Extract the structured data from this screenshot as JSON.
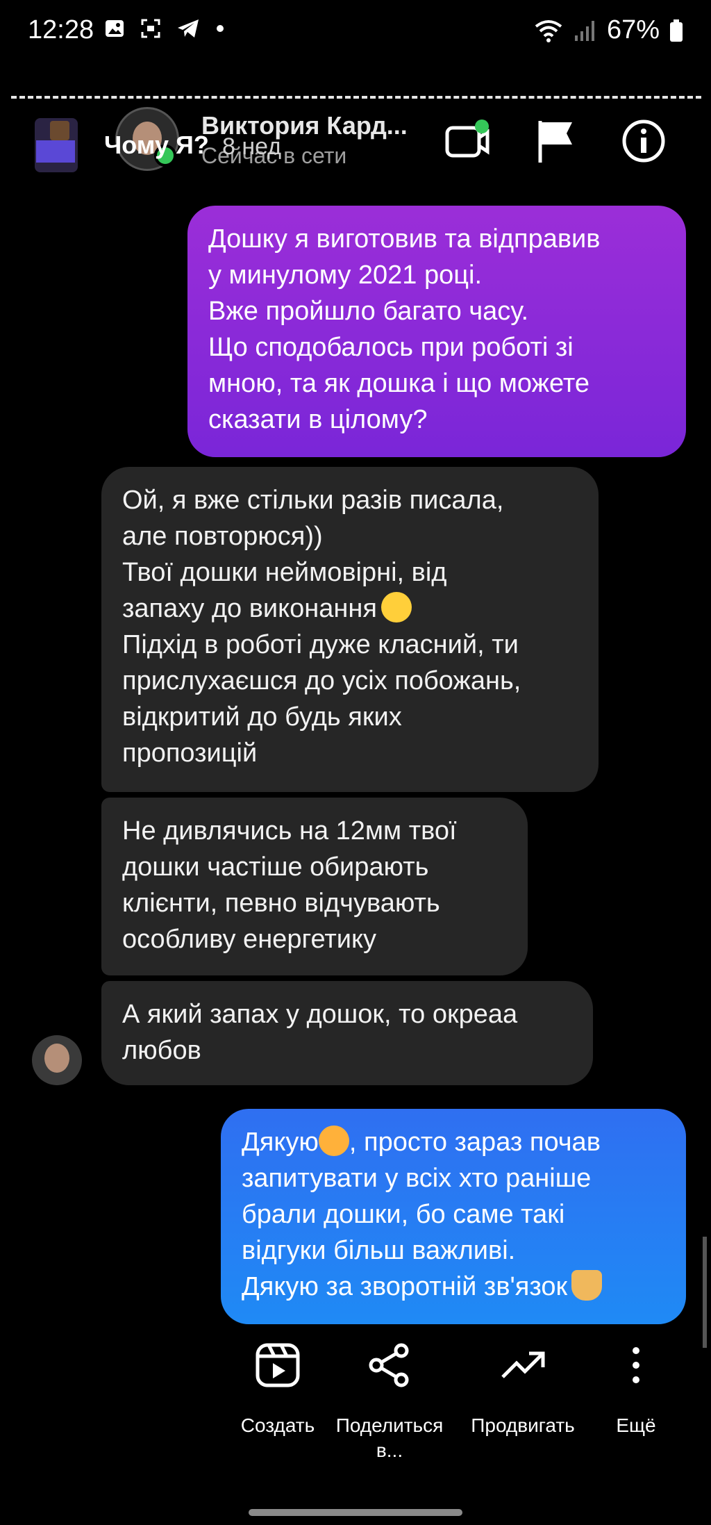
{
  "status_bar": {
    "time": "12:28",
    "icons": [
      "gallery-icon",
      "screenshot-icon",
      "telegram-icon",
      "dot-icon"
    ],
    "battery": "67%"
  },
  "header": {
    "story_caption": "Чому Я?",
    "contact_name": "Виктория Кард...",
    "contact_status": "Сейчас в сети",
    "time_ago": "8 нед"
  },
  "messages": [
    {
      "side": "out",
      "lines": [
        "Дошку я виготовив та відправив",
        "у минулому 2021 році.",
        "Вже пройшло багато часу.",
        "Що сподобалось при роботі зі",
        "мною, та як дошка і що можете",
        "сказати в цілому?"
      ]
    },
    {
      "side": "in",
      "lines": [
        "Ой, я вже стільки разів писала,",
        "але повторюся))",
        "Твої дошки неймовірні, від",
        "запаху до виконання",
        "Підхід в роботі дуже класний, ти",
        "прислухаєшся до усіх побожань,",
        "відкритий до будь яких",
        "пропозицій"
      ]
    },
    {
      "side": "in",
      "lines": [
        "Не дивлячись на 12мм твої",
        "дошки частіше обирають",
        "клієнти, певно відчувають",
        "особливу енергетику"
      ]
    },
    {
      "side": "in",
      "lines": [
        "А який запах у дошок, то окреаа",
        "любов"
      ]
    },
    {
      "side": "out",
      "lines": [
        "Дякую",
        ", просто зараз почав",
        "запитувати у всіх хто раніше",
        "брали дошки, бо саме такі",
        "відгуки більш важливі.",
        "Дякую за зворотній зв'язок"
      ]
    }
  ],
  "actions": [
    {
      "label": "Создать",
      "icon": "reels-icon"
    },
    {
      "label": "Поделиться в...",
      "icon": "share-icon"
    },
    {
      "label": "Продвигать",
      "icon": "trending-icon"
    },
    {
      "label": "Ещё",
      "icon": "more-icon"
    }
  ]
}
